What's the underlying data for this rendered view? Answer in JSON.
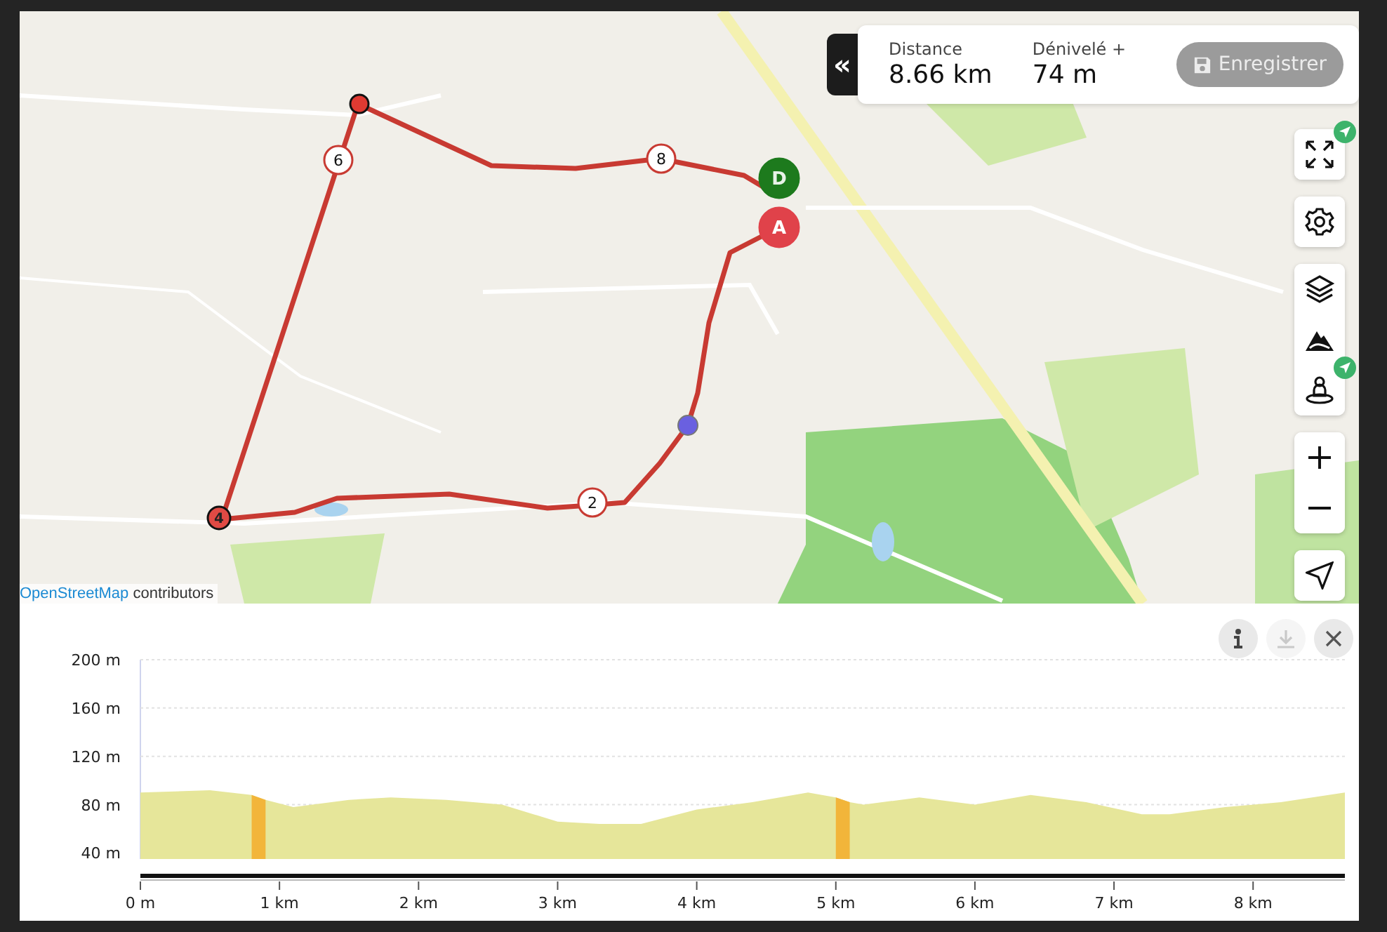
{
  "stats_panel": {
    "collapse_label": "«",
    "stats": [
      {
        "label": "Distance",
        "value": "8.66 km"
      },
      {
        "label": "Dénivelé +",
        "value": "74 m"
      }
    ],
    "save_button": {
      "label": "Enregistrer",
      "disabled": true
    }
  },
  "map": {
    "kind": "picture",
    "route_markers": [
      {
        "label": "6",
        "kind": "km"
      },
      {
        "label": "8",
        "kind": "km"
      },
      {
        "label": "2",
        "kind": "km"
      },
      {
        "label": "4",
        "kind": "waypoint"
      },
      {
        "label": "D",
        "kind": "end"
      },
      {
        "label": "A",
        "kind": "start"
      }
    ],
    "attribution": {
      "link": "OpenStreetMap",
      "text": "contributors"
    }
  },
  "elevation_panel": {
    "buttons": [
      {
        "kind": "info",
        "disabled": false
      },
      {
        "kind": "download",
        "disabled": true
      },
      {
        "kind": "close",
        "disabled": false
      }
    ],
    "chart_data": {
      "type": "area",
      "grid": true,
      "x": [
        0,
        0.5,
        0.8,
        0.9,
        1.1,
        1.5,
        1.8,
        2.2,
        2.6,
        3,
        3.3,
        3.6,
        4,
        4.4,
        4.8,
        5,
        5.1,
        5.2,
        5.6,
        6,
        6.4,
        6.8,
        7.2,
        7.4,
        7.8,
        8.2,
        8.66
      ],
      "series": [
        {
          "color": "#e6e69a",
          "values": [
            90,
            92,
            88,
            84,
            78,
            84,
            86,
            84,
            80,
            66,
            64,
            64,
            76,
            82,
            90,
            86,
            82,
            80,
            86,
            80,
            88,
            82,
            72,
            72,
            78,
            82,
            90
          ]
        },
        {
          "color": "#f2b53a",
          "values": [
            null,
            null,
            88,
            84,
            null,
            null,
            null,
            null,
            null,
            null,
            null,
            null,
            null,
            null,
            null,
            86,
            82,
            null,
            null,
            null,
            null,
            null,
            null,
            null,
            null,
            null,
            null
          ]
        }
      ],
      "xlim": [
        0,
        8.66
      ],
      "ylim": [
        35,
        200
      ],
      "xticks": [
        {
          "value": 0,
          "label": "0 m"
        },
        {
          "value": 1,
          "label": "1 km"
        },
        {
          "value": 2,
          "label": "2 km"
        },
        {
          "value": 3,
          "label": "3 km"
        },
        {
          "value": 4,
          "label": "4 km"
        },
        {
          "value": 5,
          "label": "5 km"
        },
        {
          "value": 6,
          "label": "6 km"
        },
        {
          "value": 7,
          "label": "7 km"
        },
        {
          "value": 8,
          "label": "8 km"
        }
      ],
      "yticks": [
        {
          "value": 40,
          "label": "40 m"
        },
        {
          "value": 80,
          "label": "80 m"
        },
        {
          "value": 120,
          "label": "120 m"
        },
        {
          "value": 160,
          "label": "160 m"
        },
        {
          "value": 200,
          "label": "200 m"
        }
      ]
    }
  }
}
